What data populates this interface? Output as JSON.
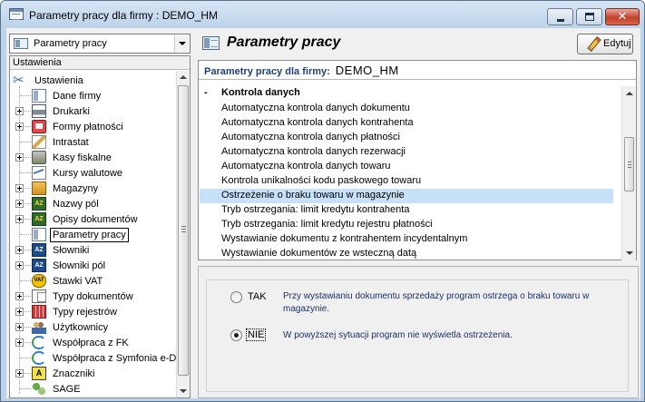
{
  "window": {
    "title": "Parametry pracy dla firmy : DEMO_HM",
    "close_glyph": "✕"
  },
  "left": {
    "combo_value": "Parametry pracy",
    "tree_header": "Ustawienia",
    "tree": [
      {
        "label": "Ustawienia",
        "icon": "tools-icon"
      },
      {
        "label": "Dane firmy",
        "icon": "company-data-icon"
      },
      {
        "label": "Drukarki",
        "icon": "printer-icon"
      },
      {
        "label": "Formy płatności",
        "icon": "payment-forms-icon"
      },
      {
        "label": "Intrastat",
        "icon": "pencil-doc-icon"
      },
      {
        "label": "Kasy fiskalne",
        "icon": "cash-register-icon"
      },
      {
        "label": "Kursy walutowe",
        "icon": "chart-icon"
      },
      {
        "label": "Magazyny",
        "icon": "warehouse-icon"
      },
      {
        "label": "Nazwy pól",
        "icon": "az-dictionary-icon"
      },
      {
        "label": "Opisy dokumentów",
        "icon": "az-dictionary-icon"
      },
      {
        "label": "Parametry pracy",
        "icon": "work-parameters-icon"
      },
      {
        "label": "Słowniki",
        "icon": "az-dictionary-icon"
      },
      {
        "label": "Słowniki pól",
        "icon": "az-dictionary-icon"
      },
      {
        "label": "Stawki VAT",
        "icon": "vat-icon"
      },
      {
        "label": "Typy dokumentów",
        "icon": "document-types-icon"
      },
      {
        "label": "Typy rejestrów",
        "icon": "grid-icon"
      },
      {
        "label": "Użytkownicy",
        "icon": "users-icon"
      },
      {
        "label": "Współpraca z FK",
        "icon": "sync-icon"
      },
      {
        "label": "Współpraca z Symfonia e-Dok",
        "icon": "sync-icon"
      },
      {
        "label": "Znaczniki",
        "icon": "marker-icon"
      },
      {
        "label": "SAGE",
        "icon": "sage-icon"
      }
    ],
    "az_glyph": "AZ",
    "vat_glyph": "VAT",
    "marker_glyph": "A",
    "tools_glyph": "✂"
  },
  "right": {
    "title": "Parametry pracy",
    "edit_label": "Edytuj",
    "params_label": "Parametry pracy dla firmy:",
    "firm_name": "DEMO_HM",
    "section_marker": "-",
    "section_label": "Kontrola danych",
    "items": [
      "Automatyczna kontrola danych dokumentu",
      "Automatyczna kontrola danych kontrahenta",
      "Automatyczna kontrola danych płatności",
      "Automatyczna kontrola danych rezerwacji",
      "Automatyczna kontrola danych towaru",
      "Kontrola unikalności kodu paskowego towaru",
      "Ostrzeżenie o braku towaru w magazynie",
      "Tryb ostrzegania: limit kredytu kontrahenta",
      "Tryb ostrzegania: limit kredytu rejestru płatności",
      "Wystawianie dokumentu z kontrahentem incydentalnym",
      "Wystawianie dokumentów ze wsteczną datą"
    ],
    "selected_item_index": 6,
    "options": [
      {
        "label": "TAK",
        "checked": false,
        "description": "Przy wystawianiu dokumentu sprzedaży program ostrzega o braku towaru w magazynie."
      },
      {
        "label": "NIE",
        "checked": true,
        "description": "W powyższej sytuacji program nie wyświetla ostrzeżenia."
      }
    ]
  }
}
